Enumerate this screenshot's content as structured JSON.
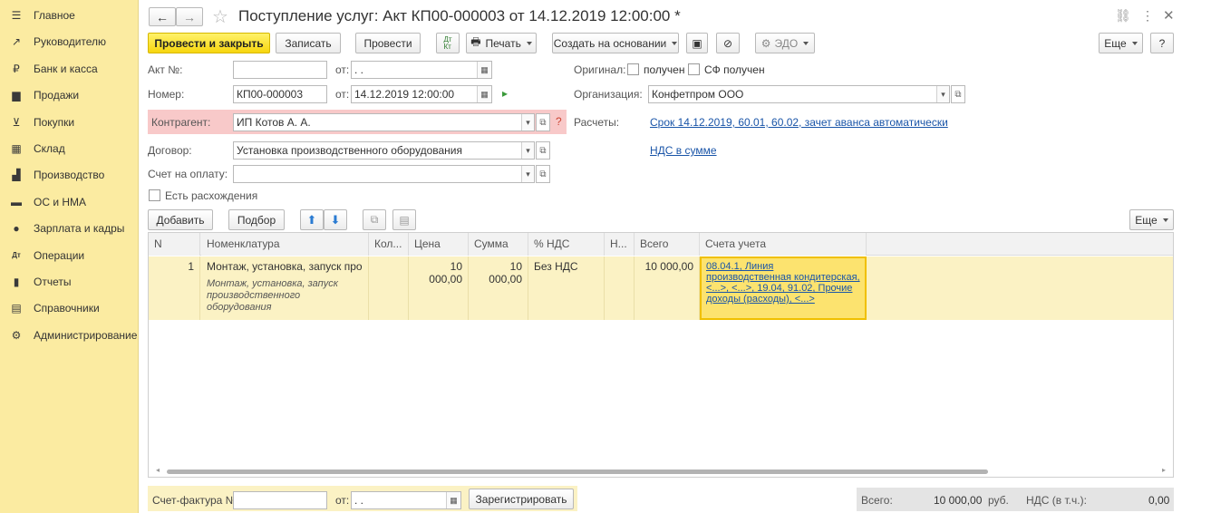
{
  "sidebar": {
    "items": [
      {
        "label": "Главное",
        "icon": "menu-icon",
        "glyph": "☰"
      },
      {
        "label": "Руководителю",
        "icon": "chart-trend-icon",
        "glyph": "↗"
      },
      {
        "label": "Банк и касса",
        "icon": "coin-icon",
        "glyph": "₽"
      },
      {
        "label": "Продажи",
        "icon": "shopping-bag-icon",
        "glyph": "▆"
      },
      {
        "label": "Покупки",
        "icon": "cart-icon",
        "glyph": "⊻"
      },
      {
        "label": "Склад",
        "icon": "warehouse-icon",
        "glyph": "▦"
      },
      {
        "label": "Производство",
        "icon": "factory-icon",
        "glyph": "▟"
      },
      {
        "label": "ОС и НМА",
        "icon": "truck-icon",
        "glyph": "▬"
      },
      {
        "label": "Зарплата и кадры",
        "icon": "person-icon",
        "glyph": "●"
      },
      {
        "label": "Операции",
        "icon": "operations-icon",
        "glyph": "Дт"
      },
      {
        "label": "Отчеты",
        "icon": "bar-chart-icon",
        "glyph": "▮"
      },
      {
        "label": "Справочники",
        "icon": "book-icon",
        "glyph": "▤"
      },
      {
        "label": "Администрирование",
        "icon": "gear-icon",
        "glyph": "⚙"
      }
    ]
  },
  "title": "Поступление услуг: Акт КП00-000003 от 14.12.2019 12:00:00 *",
  "toolbar": {
    "post_close": "Провести и закрыть",
    "save": "Записать",
    "post": "Провести",
    "print": "Печать",
    "create_based": "Создать на основании",
    "edo": "ЭДО",
    "more": "Еще",
    "help": "?"
  },
  "form": {
    "act_label": "Акт №:",
    "act_value": "",
    "from_label": "от:",
    "act_date_value": " . .",
    "number_label": "Номер:",
    "number_value": "КП00-000003",
    "date_value": "14.12.2019 12:00:00",
    "contractor_label": "Контрагент:",
    "contractor_value": "ИП Котов А. А.",
    "contract_label": "Договор:",
    "contract_value": "Установка производственного оборудования",
    "invoice_label": "Счет на оплату:",
    "invoice_value": "",
    "discrepancy_label": "Есть расхождения",
    "original_label": "Оригинал:",
    "received_label": "получен",
    "sf_received_label": "СФ получен",
    "org_label": "Организация:",
    "org_value": "Конфетпром ООО",
    "settlements_label": "Расчеты:",
    "settlements_link": "Срок 14.12.2019, 60.01, 60.02, зачет аванса автоматически",
    "vat_link": "НДС в сумме"
  },
  "table_toolbar": {
    "add": "Добавить",
    "pick": "Подбор",
    "more": "Еще"
  },
  "table": {
    "columns": [
      "N",
      "Номенклатура",
      "Кол...",
      "Цена",
      "Сумма",
      "% НДС",
      "Н...",
      "Всего",
      "Счета учета"
    ],
    "rows": [
      {
        "n": "1",
        "item": "Монтаж, установка, запуск произ...",
        "item_desc": "Монтаж, установка, запуск производственного оборудования",
        "qty": "",
        "price": "10 000,00",
        "sum": "10 000,00",
        "vat_rate": "Без НДС",
        "vat": "",
        "total": "10 000,00",
        "accounts": "08.04.1, Линия производственная кондитерская, <...>, <...>, 19.04, 91.02, Прочие доходы (расходы), <...>"
      }
    ]
  },
  "footer": {
    "sf_label": "Счет-фактура №:",
    "sf_value": "",
    "from_label": "от:",
    "sf_date": " . .",
    "register": "Зарегистрировать",
    "total_label": "Всего:",
    "total_value": "10 000,00",
    "currency": "руб.",
    "vat_label": "НДС (в т.ч.):",
    "vat_value": "0,00"
  }
}
